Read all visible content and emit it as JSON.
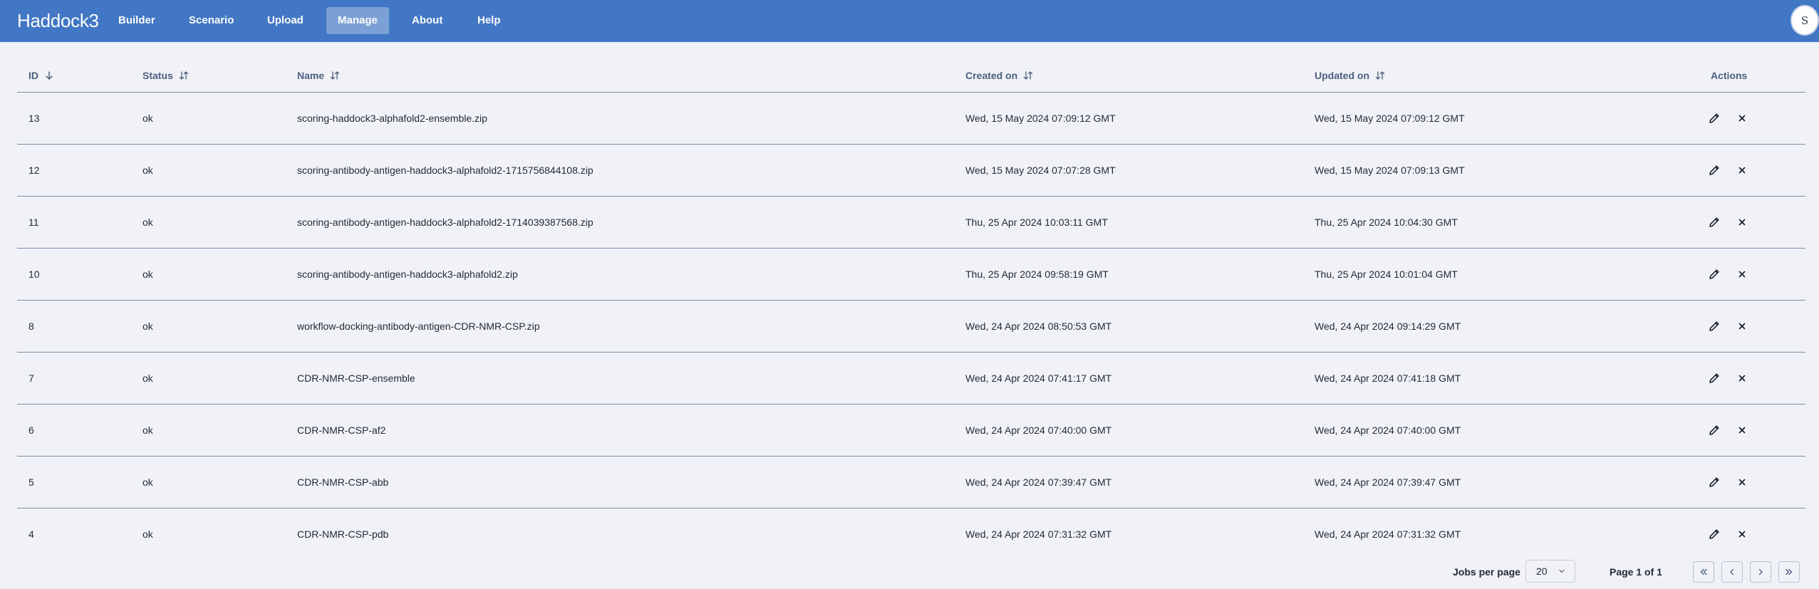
{
  "app": {
    "brand": "Haddock3"
  },
  "nav": {
    "builder": "Builder",
    "scenario": "Scenario",
    "upload": "Upload",
    "manage": "Manage",
    "about": "About",
    "help": "Help"
  },
  "user": {
    "avatar_initial": "S"
  },
  "table": {
    "headers": {
      "id": "ID",
      "status": "Status",
      "name": "Name",
      "created": "Created on",
      "updated": "Updated on",
      "actions": "Actions"
    },
    "rows": [
      {
        "id": "13",
        "status": "ok",
        "name": "scoring-haddock3-alphafold2-ensemble.zip",
        "created": "Wed, 15 May 2024 07:09:12 GMT",
        "updated": "Wed, 15 May 2024 07:09:12 GMT"
      },
      {
        "id": "12",
        "status": "ok",
        "name": "scoring-antibody-antigen-haddock3-alphafold2-1715756844108.zip",
        "created": "Wed, 15 May 2024 07:07:28 GMT",
        "updated": "Wed, 15 May 2024 07:09:13 GMT"
      },
      {
        "id": "11",
        "status": "ok",
        "name": "scoring-antibody-antigen-haddock3-alphafold2-1714039387568.zip",
        "created": "Thu, 25 Apr 2024 10:03:11 GMT",
        "updated": "Thu, 25 Apr 2024 10:04:30 GMT"
      },
      {
        "id": "10",
        "status": "ok",
        "name": "scoring-antibody-antigen-haddock3-alphafold2.zip",
        "created": "Thu, 25 Apr 2024 09:58:19 GMT",
        "updated": "Thu, 25 Apr 2024 10:01:04 GMT"
      },
      {
        "id": "8",
        "status": "ok",
        "name": "workflow-docking-antibody-antigen-CDR-NMR-CSP.zip",
        "created": "Wed, 24 Apr 2024 08:50:53 GMT",
        "updated": "Wed, 24 Apr 2024 09:14:29 GMT"
      },
      {
        "id": "7",
        "status": "ok",
        "name": "CDR-NMR-CSP-ensemble",
        "created": "Wed, 24 Apr 2024 07:41:17 GMT",
        "updated": "Wed, 24 Apr 2024 07:41:18 GMT"
      },
      {
        "id": "6",
        "status": "ok",
        "name": "CDR-NMR-CSP-af2",
        "created": "Wed, 24 Apr 2024 07:40:00 GMT",
        "updated": "Wed, 24 Apr 2024 07:40:00 GMT"
      },
      {
        "id": "5",
        "status": "ok",
        "name": "CDR-NMR-CSP-abb",
        "created": "Wed, 24 Apr 2024 07:39:47 GMT",
        "updated": "Wed, 24 Apr 2024 07:39:47 GMT"
      },
      {
        "id": "4",
        "status": "ok",
        "name": "CDR-NMR-CSP-pdb",
        "created": "Wed, 24 Apr 2024 07:31:32 GMT",
        "updated": "Wed, 24 Apr 2024 07:31:32 GMT"
      }
    ]
  },
  "pagination": {
    "per_page_label": "Jobs per page",
    "per_page_value": "20",
    "page_info": "Page 1 of 1"
  },
  "icons": {
    "sort_desc": "arrow-down-icon",
    "sort_both": "sort-arrows-icon",
    "edit": "pencil-icon",
    "delete": "close-icon",
    "first": "double-chevron-left-icon",
    "prev": "chevron-left-icon",
    "next": "chevron-right-icon",
    "last": "double-chevron-right-icon"
  },
  "colors": {
    "header_bg": "#4177c4",
    "page_bg": "#f1f2f7",
    "row_border": "#7c8da8",
    "header_text": "#4b5f7f"
  }
}
